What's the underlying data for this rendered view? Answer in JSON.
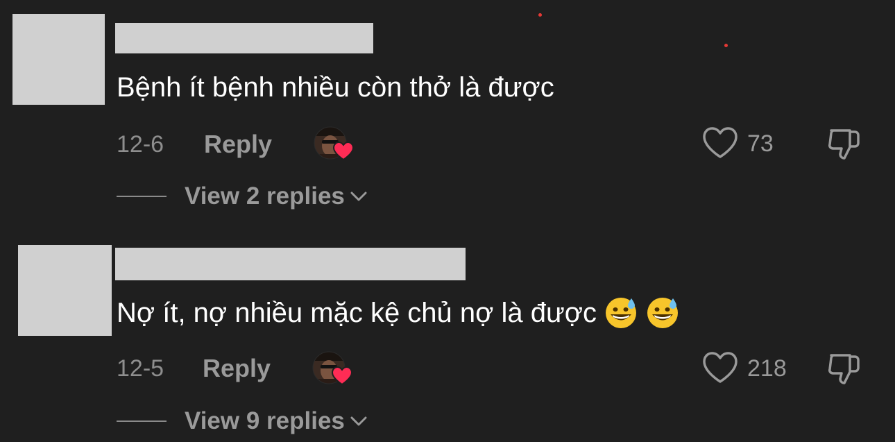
{
  "comments": [
    {
      "text": "Bệnh ít bệnh nhiều còn thở là được",
      "date": "12-6",
      "reply_label": "Reply",
      "likes": "73",
      "view_replies_label": "View 2 replies",
      "emojis": []
    },
    {
      "text": "Nợ ít, nợ nhiều mặc kệ chủ nợ là được",
      "date": "12-5",
      "reply_label": "Reply",
      "likes": "218",
      "view_replies_label": "View 9 replies",
      "emojis": [
        "grinning-face-with-sweat",
        "grinning-face-with-sweat"
      ]
    }
  ],
  "colors": {
    "background": "#1f1f1f",
    "heart_badge": "#fe2c55",
    "redaction": "#d0d0d0",
    "meta_text": "#8e8e8e"
  },
  "icons": [
    "heart-outline-icon",
    "thumbs-down-icon",
    "chevron-down-icon",
    "creator-liked-avatar-icon"
  ]
}
